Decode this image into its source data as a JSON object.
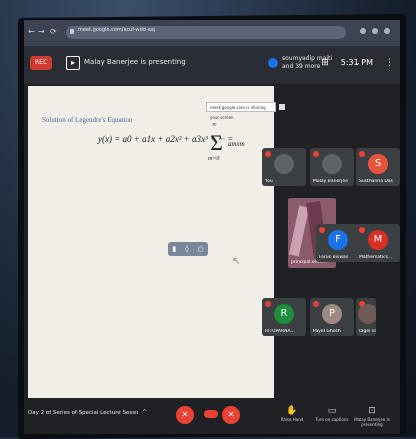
{
  "browser": {
    "url": "meet.google.com/xcuf-wdd-aaj"
  },
  "meet": {
    "rec_label": "REC",
    "presenting_text": "Malay Banerjee is presenting",
    "people_text": "soumyadip maiti and 39 more",
    "clock": "5:31 PM"
  },
  "slide": {
    "title": "Solution of Legendre's Equation",
    "equation": "y(x) = a0 + a1x + a2x² + a3x³ + ··· =",
    "sigma": "Σ",
    "sigma_top": "∞",
    "sigma_bottom": "m=0",
    "sigma_term": "amxm",
    "tooltip": "meet.google.com is sharing your screen"
  },
  "participants": [
    {
      "name": "You",
      "initial": "",
      "color": "#5f6368"
    },
    {
      "name": "Malay Banerjee",
      "initial": "",
      "color": "#5f6368"
    },
    {
      "name": "Susthanna Das",
      "initial": "S",
      "color": "#e8543b"
    },
    {
      "name": "Faruk Biswas",
      "initial": "F",
      "color": "#1a73e8"
    },
    {
      "name": "Mathematics...",
      "initial": "M",
      "color": "#d93025"
    },
    {
      "name": "RITUPARNA...",
      "initial": "R",
      "color": "#1e8e3e"
    },
    {
      "name": "Payel Ghosh",
      "initial": "P",
      "color": "#9e8a80"
    },
    {
      "name": "tagel sarkar",
      "initial": "",
      "color": "#6d5a52"
    }
  ],
  "video_tile_name": "principal.seen...",
  "bottom": {
    "meeting_name": "Day 2 of Series of Special Lecture Sessio...",
    "raise_hand": "Raise Hand",
    "captions": "Turn on captions",
    "present": "Malay Banerjee is presenting"
  }
}
